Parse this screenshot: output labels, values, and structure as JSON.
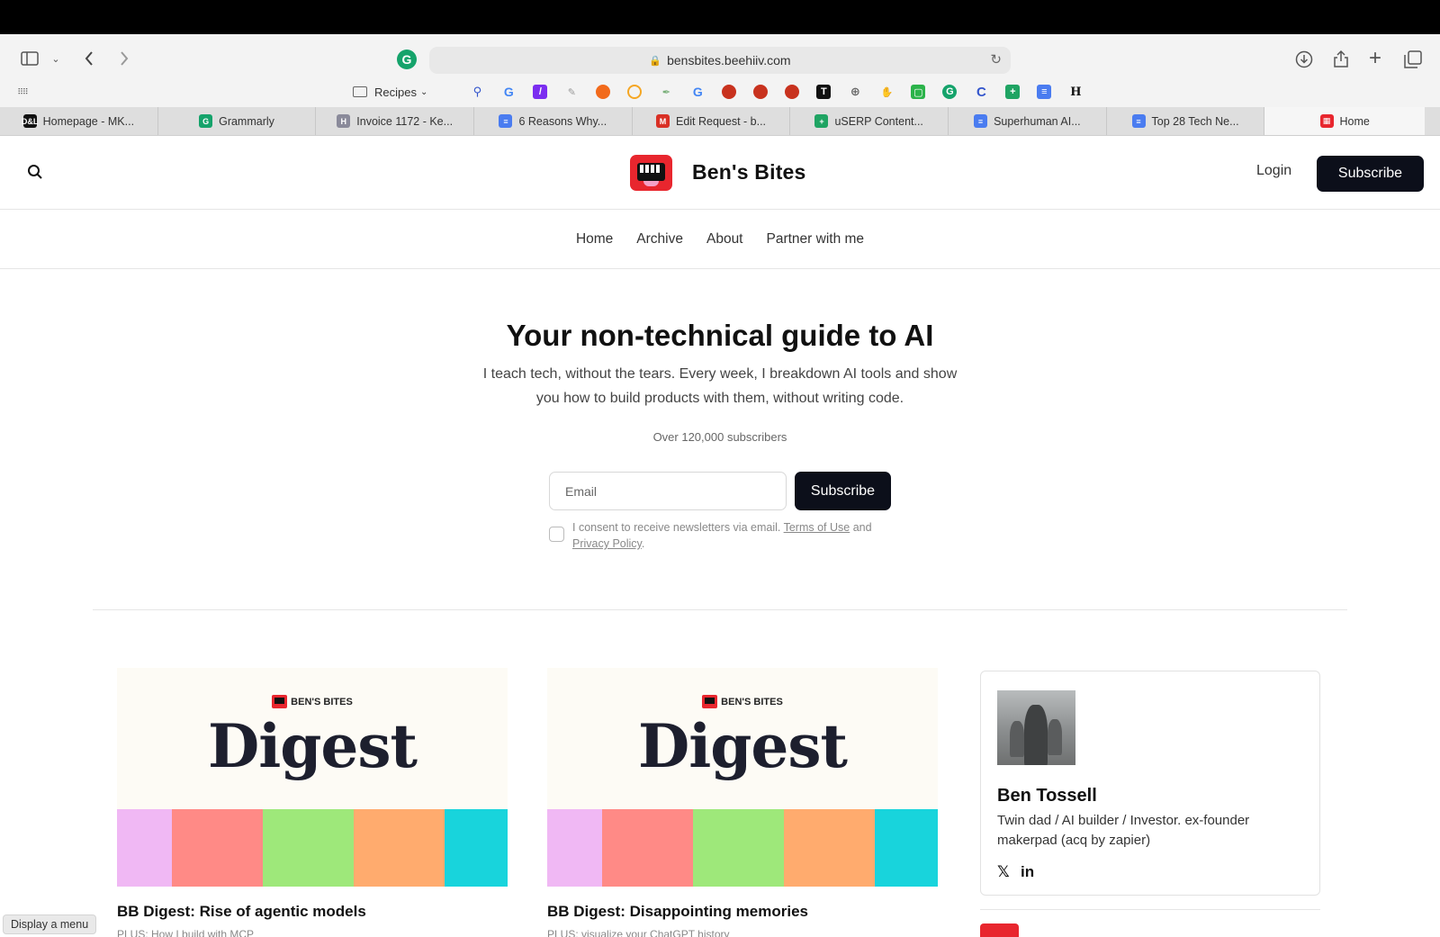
{
  "browser": {
    "url": "bensbites.beehiiv.com",
    "bookmarks_folder": "Recipes",
    "tabs": [
      {
        "label": "Homepage - MK...",
        "icon": "D&L",
        "color": "#111111"
      },
      {
        "label": "Grammarly",
        "icon": "G",
        "color": "#15a36b"
      },
      {
        "label": "Invoice 1172 - Ke...",
        "icon": "H",
        "color": "#8a8a9a"
      },
      {
        "label": "6 Reasons Why...",
        "icon": "≡",
        "color": "#4a7cf0"
      },
      {
        "label": "Edit Request - b...",
        "icon": "M",
        "color": "#d93025"
      },
      {
        "label": "uSERP Content...",
        "icon": "+",
        "color": "#1fa463"
      },
      {
        "label": "Superhuman AI...",
        "icon": "≡",
        "color": "#4a7cf0"
      },
      {
        "label": "Top 28 Tech Ne...",
        "icon": "≡",
        "color": "#4a7cf0"
      },
      {
        "label": "Home",
        "icon": "▦",
        "color": "#e8262e"
      }
    ]
  },
  "site": {
    "brand": "Ben's Bites",
    "login": "Login",
    "subscribe": "Subscribe",
    "nav": [
      "Home",
      "Archive",
      "About",
      "Partner with me"
    ]
  },
  "hero": {
    "title": "Your non-technical guide to AI",
    "subtitle": "I teach tech, without the tears. Every week, I breakdown AI tools and show you how to build products with them, without writing code.",
    "subscribers": "Over 120,000 subscribers",
    "email_placeholder": "Email",
    "subscribe": "Subscribe",
    "consent_prefix": "I consent to receive newsletters via email.",
    "terms": "Terms of Use",
    "and": "and",
    "privacy": "Privacy Policy",
    "period": "."
  },
  "posts": [
    {
      "brand": "BEN'S BITES",
      "thumb_title": "Digest",
      "title": "BB Digest: Rise of agentic models",
      "subtitle": "PLUS: How I build with MCP"
    },
    {
      "brand": "BEN'S BITES",
      "thumb_title": "Digest",
      "title": "BB Digest: Disappointing memories",
      "subtitle": "PLUS: visualize your ChatGPT history"
    }
  ],
  "stripe_colors": [
    "#f0b8f4",
    "#ff8a86",
    "#9ee87a",
    "#ffab6e",
    "#18d4dc"
  ],
  "author": {
    "name": "Ben Tossell",
    "bio": "Twin dad / AI builder / Investor. ex-founder makerpad (acq by zapier)",
    "x_icon": "𝕏",
    "linkedin_icon": "in"
  },
  "tooltip": "Display a menu"
}
